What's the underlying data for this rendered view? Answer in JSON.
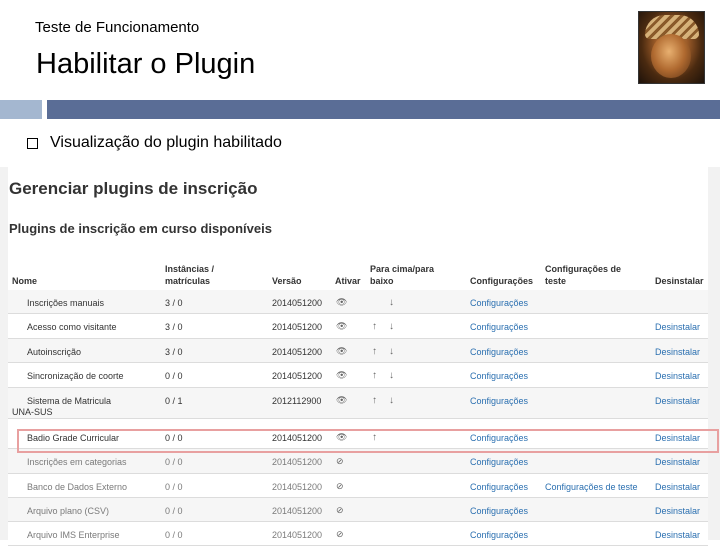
{
  "slide": {
    "subtitle": "Teste de Funcionamento",
    "title": "Habilitar o Plugin",
    "bullet": "Visualização do plugin habilitado"
  },
  "screenshot": {
    "page_title": "Gerenciar plugins de inscrição",
    "section_title": "Plugins de inscrição em curso disponíveis",
    "headers": {
      "name": "Nome",
      "instances": "Instâncias / matrículas",
      "version": "Versão",
      "enable": "Ativar",
      "updown": "Para cima/para baixo",
      "settings": "Configurações",
      "test_settings": "Configurações de teste",
      "uninstall": "Desinstalar"
    },
    "rows": [
      {
        "name": "Inscrições manuais",
        "inst": "3 / 0",
        "version": "2014051200",
        "eye": "visible",
        "up": false,
        "down": true,
        "settings": "Configurações",
        "test": "",
        "uninstall": "",
        "disabled": false
      },
      {
        "name": "Acesso como visitante",
        "inst": "3 / 0",
        "version": "2014051200",
        "eye": "visible",
        "up": true,
        "down": true,
        "settings": "Configurações",
        "test": "",
        "uninstall": "Desinstalar",
        "disabled": false
      },
      {
        "name": "Autoinscrição",
        "inst": "3 / 0",
        "version": "2014051200",
        "eye": "visible",
        "up": true,
        "down": true,
        "settings": "Configurações",
        "test": "",
        "uninstall": "Desinstalar",
        "disabled": false
      },
      {
        "name": "Sincronização de coorte",
        "inst": "0 / 0",
        "version": "2014051200",
        "eye": "visible",
        "up": true,
        "down": true,
        "settings": "Configurações",
        "test": "",
        "uninstall": "Desinstalar",
        "disabled": false
      },
      {
        "name": "Sistema de Matricula UNA-SUS",
        "inst": "0 / 1",
        "version": "2012112900",
        "eye": "visible",
        "up": true,
        "down": true,
        "settings": "Configurações",
        "test": "",
        "uninstall": "Desinstalar",
        "disabled": false
      },
      {
        "name": "Badio Grade Curricular",
        "inst": "0 / 0",
        "version": "2014051200",
        "eye": "visible",
        "up": true,
        "down": false,
        "settings": "Configurações",
        "test": "",
        "uninstall": "Desinstalar",
        "disabled": false
      },
      {
        "name": "Inscrições em categorias",
        "inst": "0 / 0",
        "version": "2014051200",
        "eye": "hidden",
        "up": false,
        "down": false,
        "settings": "Configurações",
        "test": "",
        "uninstall": "Desinstalar",
        "disabled": true
      },
      {
        "name": "Banco de Dados Externo",
        "inst": "0 / 0",
        "version": "2014051200",
        "eye": "hidden",
        "up": false,
        "down": false,
        "settings": "Configurações",
        "test": "Configurações de teste",
        "uninstall": "Desinstalar",
        "disabled": true
      },
      {
        "name": "Arquivo plano (CSV)",
        "inst": "0 / 0",
        "version": "2014051200",
        "eye": "hidden",
        "up": false,
        "down": false,
        "settings": "Configurações",
        "test": "",
        "uninstall": "Desinstalar",
        "disabled": true
      },
      {
        "name": "Arquivo IMS Enterprise",
        "inst": "0 / 0",
        "version": "2014051200",
        "eye": "hidden",
        "up": false,
        "down": false,
        "settings": "Configurações",
        "test": "",
        "uninstall": "Desinstalar",
        "disabled": true
      }
    ]
  },
  "colors": {
    "link": "#2a6fb0",
    "bar_light": "#a4b7d0",
    "bar_dark": "#5a6d96",
    "highlight": "#e8a0a0"
  }
}
